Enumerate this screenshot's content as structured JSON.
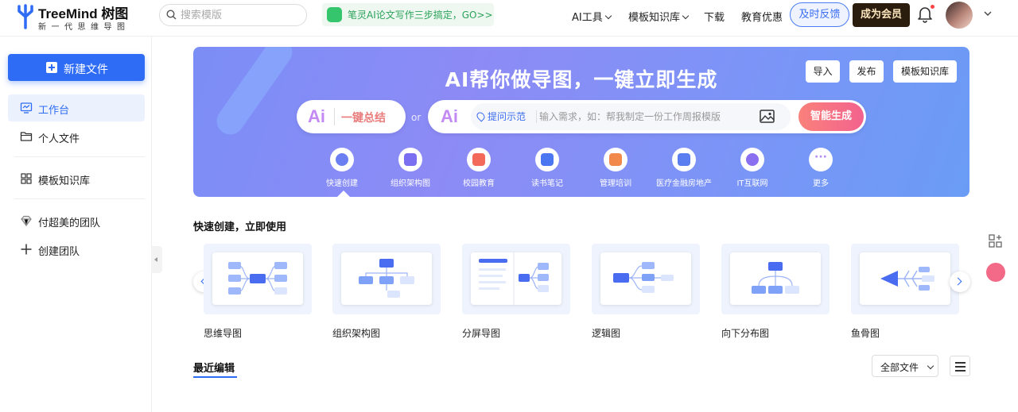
{
  "header": {
    "logo_title": "TreeMind 树图",
    "logo_subtitle": "新一代思维导图",
    "search_placeholder": "搜索模版",
    "promo_text": "笔灵AI论文写作三步搞定，GO>>",
    "nav": [
      "AI工具",
      "模板知识库",
      "下载",
      "教育优惠"
    ],
    "feedback_label": "及时反馈",
    "vip_label": "成为会员"
  },
  "sidebar": {
    "new_file_label": "新建文件",
    "items": [
      {
        "label": "工作台",
        "icon": "monitor-icon"
      },
      {
        "label": "个人文件",
        "icon": "folder-icon"
      },
      {
        "label": "模板知识库",
        "icon": "grid-icon"
      },
      {
        "label": "付超美的团队",
        "icon": "diamond-icon"
      },
      {
        "label": "创建团队",
        "icon": "plus-icon"
      }
    ]
  },
  "banner": {
    "title": "AI帮你做导图，一键立即生成",
    "buttons": [
      "导入",
      "发布",
      "模板知识库"
    ],
    "summary_label": "一键总结",
    "ai_mark": "Ai",
    "or": "or",
    "hint_label": "提问示范",
    "input_placeholder": "输入需求，如：帮我制定一份工作周报模版",
    "generate_label": "智能生成",
    "categories": [
      {
        "label": "快速创建",
        "color": "#6b7ff2"
      },
      {
        "label": "组织架构图",
        "color": "#7a6ff0"
      },
      {
        "label": "校园教育",
        "color": "#f36a5a"
      },
      {
        "label": "读书笔记",
        "color": "#4a76f2"
      },
      {
        "label": "管理培训",
        "color": "#f2884a"
      },
      {
        "label": "医疗金融房地产",
        "color": "#5a7ef0"
      },
      {
        "label": "IT互联网",
        "color": "#8a6ff0"
      },
      {
        "label": "更多",
        "color": "#b08af5"
      }
    ]
  },
  "quick": {
    "title": "快速创建，立即使用",
    "templates": [
      "思维导图",
      "组织架构图",
      "分屏导图",
      "逻辑图",
      "向下分布图",
      "鱼骨图"
    ]
  },
  "recent": {
    "title": "最近编辑",
    "filter_value": "全部文件"
  }
}
